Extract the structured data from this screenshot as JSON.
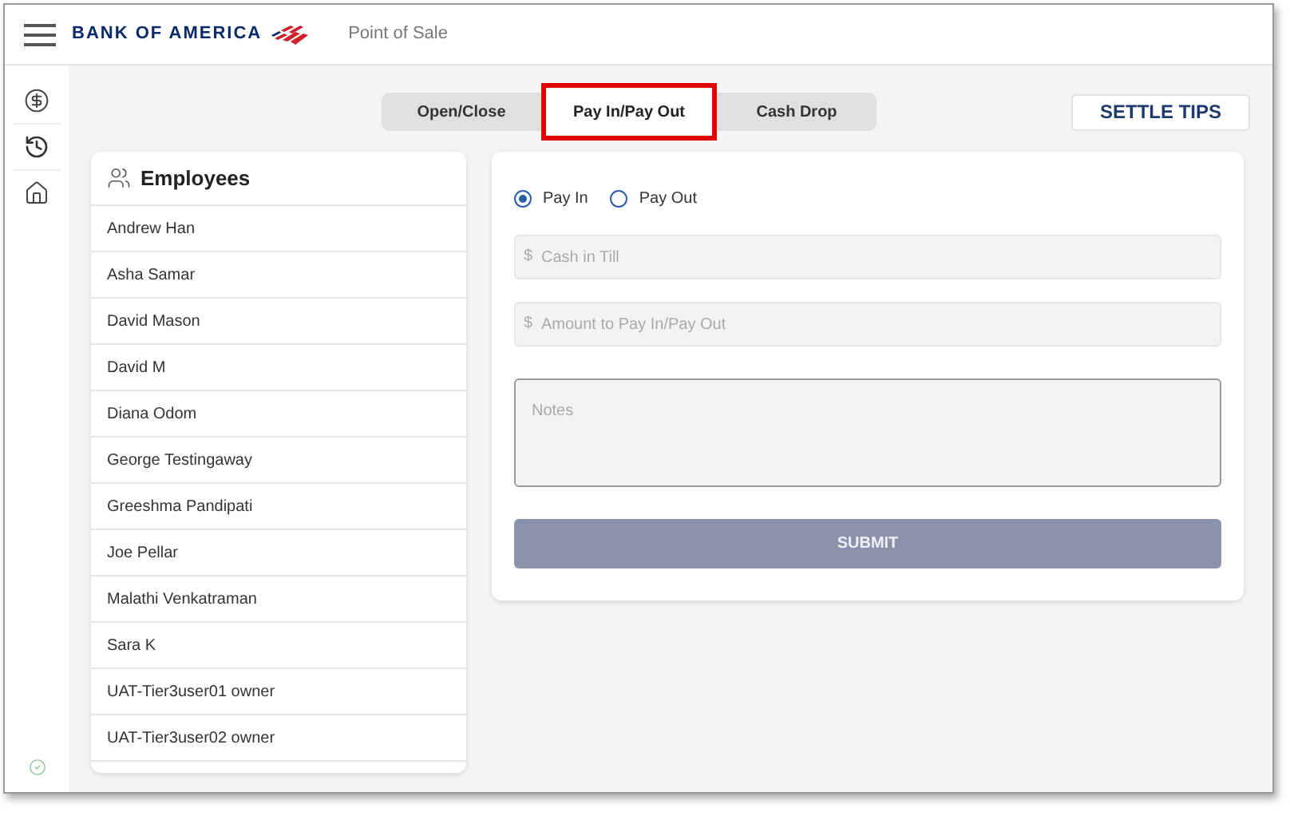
{
  "header": {
    "brand": "BANK OF AMERICA",
    "app_title": "Point of Sale"
  },
  "tabs": [
    {
      "label": "Open/Close",
      "selected": false
    },
    {
      "label": "Pay In/Pay Out",
      "selected": true
    },
    {
      "label": "Cash Drop",
      "selected": false
    }
  ],
  "settle_button": "SETTLE TIPS",
  "employees": {
    "title": "Employees",
    "items": [
      "Andrew Han",
      "Asha Samar",
      "David Mason",
      "David M",
      "Diana Odom",
      "George Testingaway",
      "Greeshma Pandipati",
      "Joe Pellar",
      "Malathi Venkatraman",
      "Sara K",
      "UAT-Tier3user01 owner",
      "UAT-Tier3user02 owner"
    ]
  },
  "form": {
    "options": [
      {
        "label": "Pay In",
        "selected": true
      },
      {
        "label": "Pay Out",
        "selected": false
      }
    ],
    "fields": [
      {
        "prefix": "$",
        "placeholder": "Cash in Till"
      },
      {
        "prefix": "$",
        "placeholder": "Amount to Pay In/Pay Out"
      }
    ],
    "notes": {
      "placeholder": "Notes"
    },
    "submit": {
      "label": "SUBMIT",
      "disabled": true
    }
  }
}
